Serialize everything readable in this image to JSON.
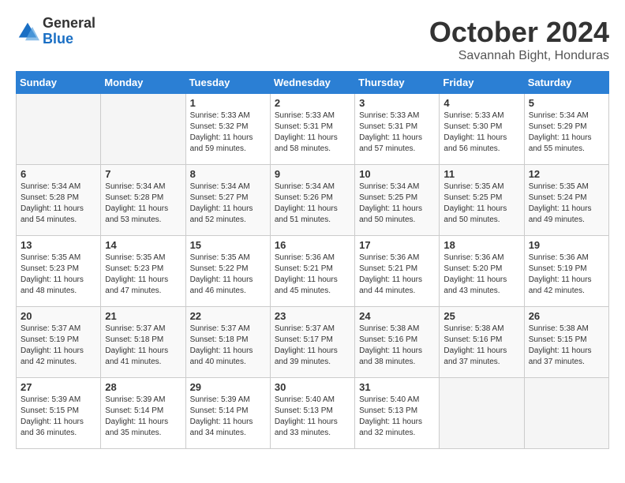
{
  "header": {
    "logo_general": "General",
    "logo_blue": "Blue",
    "month_title": "October 2024",
    "subtitle": "Savannah Bight, Honduras"
  },
  "days_of_week": [
    "Sunday",
    "Monday",
    "Tuesday",
    "Wednesday",
    "Thursday",
    "Friday",
    "Saturday"
  ],
  "weeks": [
    [
      {
        "day": "",
        "sunrise": "",
        "sunset": "",
        "daylight": ""
      },
      {
        "day": "",
        "sunrise": "",
        "sunset": "",
        "daylight": ""
      },
      {
        "day": "1",
        "sunrise": "Sunrise: 5:33 AM",
        "sunset": "Sunset: 5:32 PM",
        "daylight": "Daylight: 11 hours and 59 minutes."
      },
      {
        "day": "2",
        "sunrise": "Sunrise: 5:33 AM",
        "sunset": "Sunset: 5:31 PM",
        "daylight": "Daylight: 11 hours and 58 minutes."
      },
      {
        "day": "3",
        "sunrise": "Sunrise: 5:33 AM",
        "sunset": "Sunset: 5:31 PM",
        "daylight": "Daylight: 11 hours and 57 minutes."
      },
      {
        "day": "4",
        "sunrise": "Sunrise: 5:33 AM",
        "sunset": "Sunset: 5:30 PM",
        "daylight": "Daylight: 11 hours and 56 minutes."
      },
      {
        "day": "5",
        "sunrise": "Sunrise: 5:34 AM",
        "sunset": "Sunset: 5:29 PM",
        "daylight": "Daylight: 11 hours and 55 minutes."
      }
    ],
    [
      {
        "day": "6",
        "sunrise": "Sunrise: 5:34 AM",
        "sunset": "Sunset: 5:28 PM",
        "daylight": "Daylight: 11 hours and 54 minutes."
      },
      {
        "day": "7",
        "sunrise": "Sunrise: 5:34 AM",
        "sunset": "Sunset: 5:28 PM",
        "daylight": "Daylight: 11 hours and 53 minutes."
      },
      {
        "day": "8",
        "sunrise": "Sunrise: 5:34 AM",
        "sunset": "Sunset: 5:27 PM",
        "daylight": "Daylight: 11 hours and 52 minutes."
      },
      {
        "day": "9",
        "sunrise": "Sunrise: 5:34 AM",
        "sunset": "Sunset: 5:26 PM",
        "daylight": "Daylight: 11 hours and 51 minutes."
      },
      {
        "day": "10",
        "sunrise": "Sunrise: 5:34 AM",
        "sunset": "Sunset: 5:25 PM",
        "daylight": "Daylight: 11 hours and 50 minutes."
      },
      {
        "day": "11",
        "sunrise": "Sunrise: 5:35 AM",
        "sunset": "Sunset: 5:25 PM",
        "daylight": "Daylight: 11 hours and 50 minutes."
      },
      {
        "day": "12",
        "sunrise": "Sunrise: 5:35 AM",
        "sunset": "Sunset: 5:24 PM",
        "daylight": "Daylight: 11 hours and 49 minutes."
      }
    ],
    [
      {
        "day": "13",
        "sunrise": "Sunrise: 5:35 AM",
        "sunset": "Sunset: 5:23 PM",
        "daylight": "Daylight: 11 hours and 48 minutes."
      },
      {
        "day": "14",
        "sunrise": "Sunrise: 5:35 AM",
        "sunset": "Sunset: 5:23 PM",
        "daylight": "Daylight: 11 hours and 47 minutes."
      },
      {
        "day": "15",
        "sunrise": "Sunrise: 5:35 AM",
        "sunset": "Sunset: 5:22 PM",
        "daylight": "Daylight: 11 hours and 46 minutes."
      },
      {
        "day": "16",
        "sunrise": "Sunrise: 5:36 AM",
        "sunset": "Sunset: 5:21 PM",
        "daylight": "Daylight: 11 hours and 45 minutes."
      },
      {
        "day": "17",
        "sunrise": "Sunrise: 5:36 AM",
        "sunset": "Sunset: 5:21 PM",
        "daylight": "Daylight: 11 hours and 44 minutes."
      },
      {
        "day": "18",
        "sunrise": "Sunrise: 5:36 AM",
        "sunset": "Sunset: 5:20 PM",
        "daylight": "Daylight: 11 hours and 43 minutes."
      },
      {
        "day": "19",
        "sunrise": "Sunrise: 5:36 AM",
        "sunset": "Sunset: 5:19 PM",
        "daylight": "Daylight: 11 hours and 42 minutes."
      }
    ],
    [
      {
        "day": "20",
        "sunrise": "Sunrise: 5:37 AM",
        "sunset": "Sunset: 5:19 PM",
        "daylight": "Daylight: 11 hours and 42 minutes."
      },
      {
        "day": "21",
        "sunrise": "Sunrise: 5:37 AM",
        "sunset": "Sunset: 5:18 PM",
        "daylight": "Daylight: 11 hours and 41 minutes."
      },
      {
        "day": "22",
        "sunrise": "Sunrise: 5:37 AM",
        "sunset": "Sunset: 5:18 PM",
        "daylight": "Daylight: 11 hours and 40 minutes."
      },
      {
        "day": "23",
        "sunrise": "Sunrise: 5:37 AM",
        "sunset": "Sunset: 5:17 PM",
        "daylight": "Daylight: 11 hours and 39 minutes."
      },
      {
        "day": "24",
        "sunrise": "Sunrise: 5:38 AM",
        "sunset": "Sunset: 5:16 PM",
        "daylight": "Daylight: 11 hours and 38 minutes."
      },
      {
        "day": "25",
        "sunrise": "Sunrise: 5:38 AM",
        "sunset": "Sunset: 5:16 PM",
        "daylight": "Daylight: 11 hours and 37 minutes."
      },
      {
        "day": "26",
        "sunrise": "Sunrise: 5:38 AM",
        "sunset": "Sunset: 5:15 PM",
        "daylight": "Daylight: 11 hours and 37 minutes."
      }
    ],
    [
      {
        "day": "27",
        "sunrise": "Sunrise: 5:39 AM",
        "sunset": "Sunset: 5:15 PM",
        "daylight": "Daylight: 11 hours and 36 minutes."
      },
      {
        "day": "28",
        "sunrise": "Sunrise: 5:39 AM",
        "sunset": "Sunset: 5:14 PM",
        "daylight": "Daylight: 11 hours and 35 minutes."
      },
      {
        "day": "29",
        "sunrise": "Sunrise: 5:39 AM",
        "sunset": "Sunset: 5:14 PM",
        "daylight": "Daylight: 11 hours and 34 minutes."
      },
      {
        "day": "30",
        "sunrise": "Sunrise: 5:40 AM",
        "sunset": "Sunset: 5:13 PM",
        "daylight": "Daylight: 11 hours and 33 minutes."
      },
      {
        "day": "31",
        "sunrise": "Sunrise: 5:40 AM",
        "sunset": "Sunset: 5:13 PM",
        "daylight": "Daylight: 11 hours and 32 minutes."
      },
      {
        "day": "",
        "sunrise": "",
        "sunset": "",
        "daylight": ""
      },
      {
        "day": "",
        "sunrise": "",
        "sunset": "",
        "daylight": ""
      }
    ]
  ]
}
